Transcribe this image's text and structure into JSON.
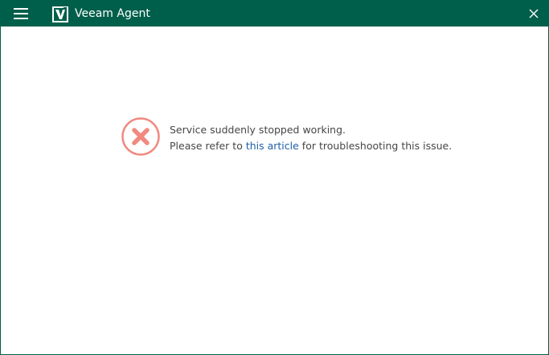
{
  "window": {
    "title": "Veeam Agent",
    "accent_color": "#005f4b"
  },
  "titlebar": {
    "menu_icon": "hamburger-menu-icon",
    "logo_icon": "veeam-logo-icon",
    "close_icon": "close-icon"
  },
  "error": {
    "icon": "error-x-icon",
    "icon_color": "#f08a80",
    "line1": "Service suddenly stopped working.",
    "line2_before": "Please refer to ",
    "link_text": "this article",
    "line2_after": " for troubleshooting this issue.",
    "link_color": "#1c5fa8"
  }
}
